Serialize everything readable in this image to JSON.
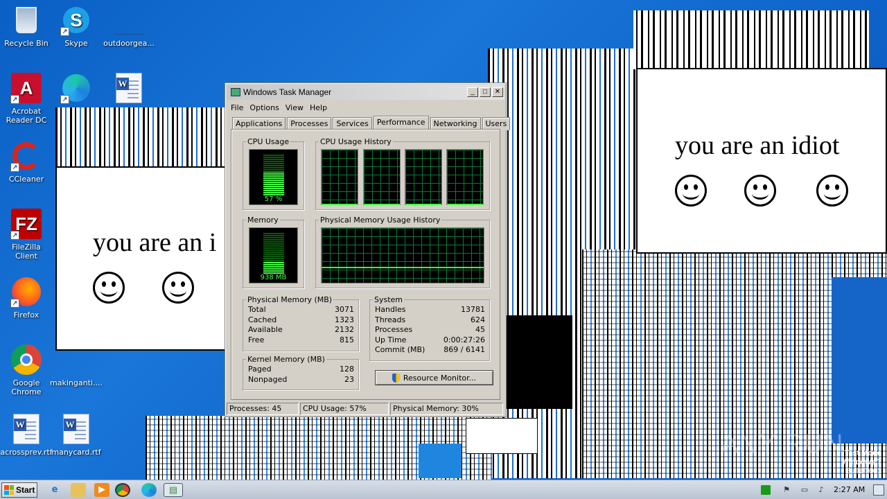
{
  "desktop": {
    "icons": [
      {
        "label": "Recycle Bin",
        "icon": "recycle-bin-icon"
      },
      {
        "label": "Skype",
        "icon": "skype-icon"
      },
      {
        "label": "outdoorgea...",
        "icon": "file-icon"
      },
      {
        "label": "Acrobat Reader DC",
        "icon": "acrobat-icon"
      },
      {
        "label": "CCleaner",
        "icon": "ccleaner-icon"
      },
      {
        "label": "FileZilla Client",
        "icon": "filezilla-icon"
      },
      {
        "label": "Firefox",
        "icon": "firefox-icon"
      },
      {
        "label": "Google Chrome",
        "icon": "chrome-icon"
      },
      {
        "label": "makinganti....",
        "icon": "file-icon"
      },
      {
        "label": "acrossprev.rtf",
        "icon": "word-document-icon"
      },
      {
        "label": "manycard.rtf",
        "icon": "word-document-icon"
      }
    ]
  },
  "idiot_windows": [
    {
      "message": "you are an idiot"
    },
    {
      "message": "you are an i"
    }
  ],
  "task_manager": {
    "title": "Windows Task Manager",
    "menu": [
      "File",
      "Options",
      "View",
      "Help"
    ],
    "tabs": [
      "Applications",
      "Processes",
      "Services",
      "Performance",
      "Networking",
      "Users"
    ],
    "active_tab": "Performance",
    "cpu_usage": {
      "label": "CPU Usage",
      "value": "57 %",
      "fraction": 0.57
    },
    "cpu_history": {
      "label": "CPU Usage History"
    },
    "memory": {
      "label": "Memory",
      "value": "938 MB",
      "fraction": 0.3
    },
    "mem_history": {
      "label": "Physical Memory Usage History"
    },
    "physical_memory": {
      "label": "Physical Memory (MB)",
      "rows": [
        {
          "name": "Total",
          "value": "3071"
        },
        {
          "name": "Cached",
          "value": "1323"
        },
        {
          "name": "Available",
          "value": "2132"
        },
        {
          "name": "Free",
          "value": "815"
        }
      ]
    },
    "kernel_memory": {
      "label": "Kernel Memory (MB)",
      "rows": [
        {
          "name": "Paged",
          "value": "128"
        },
        {
          "name": "Nonpaged",
          "value": "23"
        }
      ]
    },
    "system": {
      "label": "System",
      "rows": [
        {
          "name": "Handles",
          "value": "13781"
        },
        {
          "name": "Threads",
          "value": "624"
        },
        {
          "name": "Processes",
          "value": "45"
        },
        {
          "name": "Up Time",
          "value": "0:00:27:26"
        },
        {
          "name": "Commit (MB)",
          "value": "869 / 6141"
        }
      ]
    },
    "resource_monitor_button": "Resource Monitor...",
    "status": {
      "processes": "Processes: 45",
      "cpu": "CPU Usage: 57%",
      "memory": "Physical Memory: 30%"
    }
  },
  "taskbar": {
    "start_label": "Start",
    "clock": "2:27 AM"
  },
  "watermark": {
    "line1": "Test Mode",
    "line2": "Windows 7",
    "line3": "Build 7601",
    "brand": "ANY RUN"
  }
}
